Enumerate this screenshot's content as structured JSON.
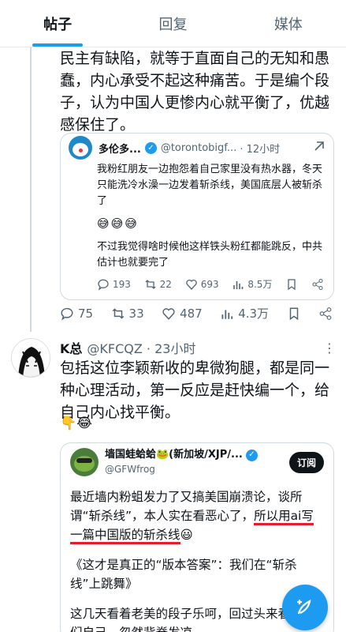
{
  "tabs": [
    {
      "label": "帖子",
      "active": true
    },
    {
      "label": "回复",
      "active": false
    },
    {
      "label": "媒体",
      "active": false
    }
  ],
  "post1": {
    "text": "民主有缺陷，就等于直面自己的无知和愚蠢，内心承受不起这种痛苦。于是编个段子，认为中国人更惨内心就平衡了，优越感保住了。",
    "quote": {
      "name": "多伦多...",
      "handle": "@torontobigf...",
      "time": "· 12小时",
      "text1": "我粉红朋友一边抱怨着自己家里没有热水器，冬天只能洗冷水澡一边发着斩杀线，美国底层人被斩杀了",
      "emojis": "😅😅😅",
      "text2": "不过我觉得啥时候他这样铁头粉红都能跳反，中共估计也就要完了",
      "replies": "193",
      "retweets": "22",
      "likes": "693",
      "views": "8.5万"
    },
    "actions": {
      "replies": "75",
      "retweets": "33",
      "likes": "487",
      "views": "4.3万"
    }
  },
  "post2": {
    "name": "K总",
    "handle": "@KFCQZ · 23小时",
    "more": "⋮",
    "text": "包括这位李颖新收的卑微狗腿，都是同一种心理活动，第一反应是赶快编一个，给自己内心找平衡。",
    "emojis": "👇😂",
    "quote": {
      "name": "墙国蛙蛤蛤🐸(新加坡/XJP/...",
      "handle": "@GFWfrog",
      "subscribe": "订阅",
      "p1_a": "最近墙内粉蛆发力了又搞美国崩溃论，谈所谓“斩杀线”，本人实在看恶心了，",
      "p1_b": "所以用ai写一篇中国版的斩杀线",
      "p1_c": "😃",
      "p2": "《这才是真正的“版本答案”：我们在“斩杀线”上跳舞》",
      "p3": "这几天看着老美的段子乐呵，回过头来看看我们自己，忽然背脊发凉。"
    }
  },
  "colors": {
    "accent": "#1d9bf0",
    "highlight": "#e0202a"
  },
  "icons": {
    "fab": "compose-icon"
  }
}
